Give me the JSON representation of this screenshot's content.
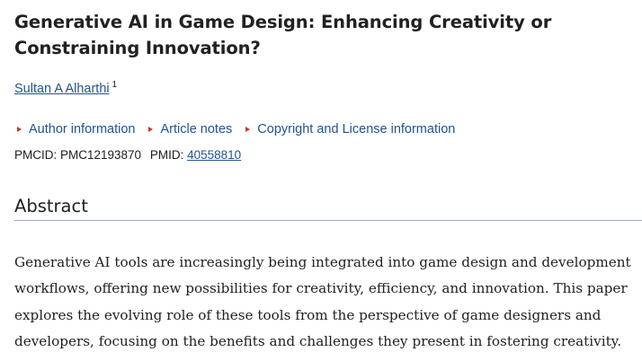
{
  "article": {
    "title": "Generative AI in Game Design: Enhancing Creativity or Constraining Innovation?",
    "author": {
      "name": "Sultan A Alharthi",
      "affiliation_marker": "1"
    },
    "toggles": [
      {
        "label": "Author information"
      },
      {
        "label": "Article notes"
      },
      {
        "label": "Copyright and License information"
      }
    ],
    "ids": {
      "pmcid_label": "PMCID: PMC12193870",
      "pmid_label": "PMID:",
      "pmid_value": "40558810"
    }
  },
  "abstract": {
    "heading": "Abstract",
    "text": "Generative AI tools are increasingly being integrated into game design and development workflows, offering new possibilities for creativity, efficiency, and innovation. This paper explores the evolving role of these tools from the perspective of game designers and developers, focusing on the benefits and challenges they present in fostering creativity."
  }
}
